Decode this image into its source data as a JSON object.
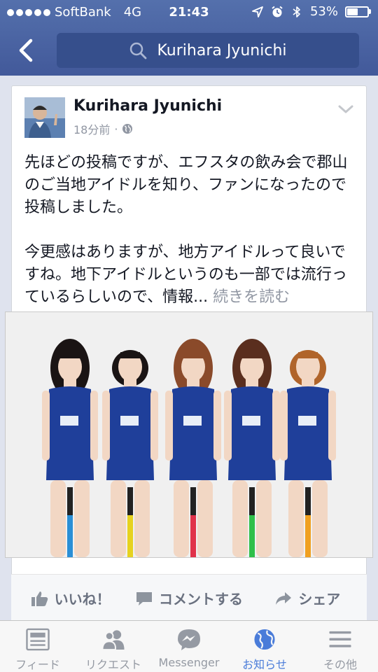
{
  "status_bar": {
    "carrier": "SoftBank",
    "network": "4G",
    "time": "21:43",
    "battery_percent": "53%",
    "battery_level": 0.53
  },
  "nav": {
    "search_text": "Kurihara Jyunichi"
  },
  "post": {
    "author": "Kurihara Jyunichi",
    "time_ago": "18分前",
    "separator": "·",
    "paragraph1": "先ほどの投稿ですが、エフスタの飲み会で郡山のご当地アイドルを知り、ファンになったので投稿しました。",
    "paragraph2": "今更感はありますが、地方アイドルって良いですね。地下アイドルというのも一部では流行っているらしいので、情報...",
    "read_more": "続きを読む"
  },
  "actions": {
    "like": "いいね！",
    "comment": "コメントする",
    "share": "シェア"
  },
  "tabs": [
    {
      "label": "フィード",
      "icon": "news-feed-icon"
    },
    {
      "label": "リクエスト",
      "icon": "friend-requests-icon"
    },
    {
      "label": "Messenger",
      "icon": "messenger-icon"
    },
    {
      "label": "お知らせ",
      "icon": "notifications-globe-icon"
    },
    {
      "label": "その他",
      "icon": "more-menu-icon"
    }
  ],
  "colors": {
    "header": "#4a64a1",
    "active_tab": "#4a7cd9",
    "inactive_tab": "#959aa3"
  }
}
